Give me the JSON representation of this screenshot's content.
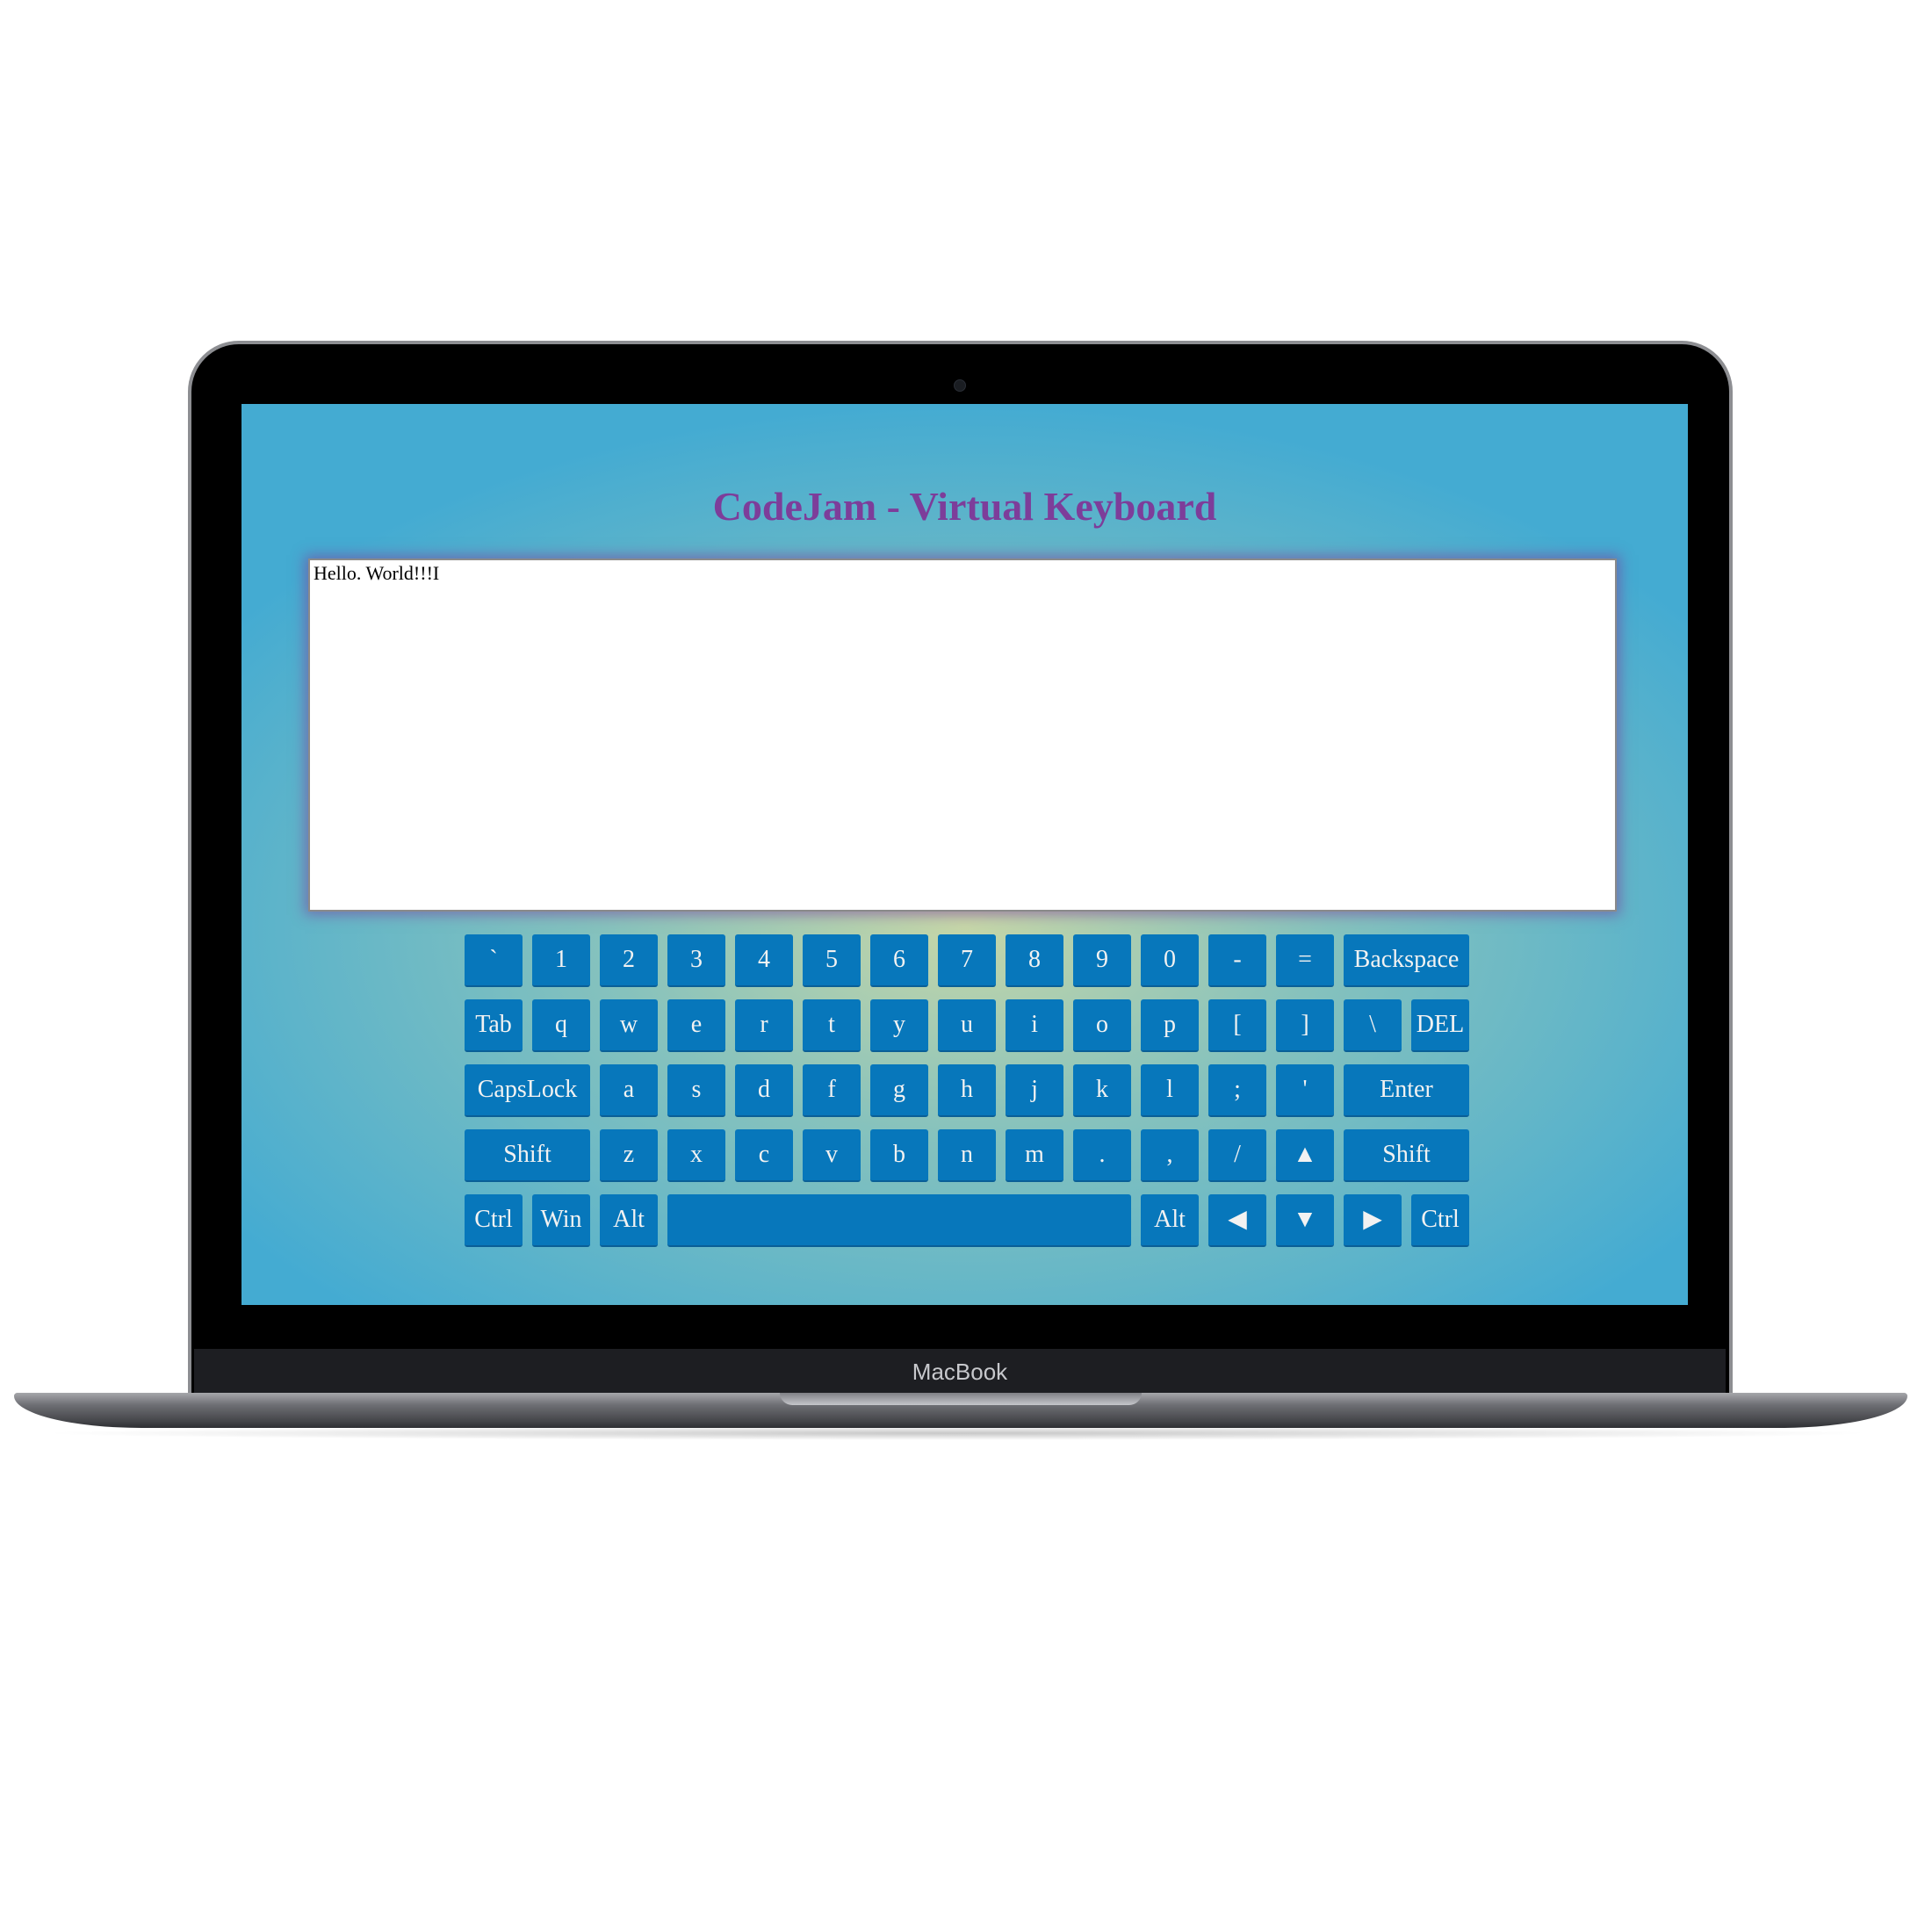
{
  "device": {
    "brand": "MacBook"
  },
  "app": {
    "title": "CodeJam - Virtual Keyboard",
    "textarea_value": "Hello. World!!!I"
  },
  "keyboard": {
    "rows": [
      [
        "`",
        "1",
        "2",
        "3",
        "4",
        "5",
        "6",
        "7",
        "8",
        "9",
        "0",
        "-",
        "=",
        "Backspace"
      ],
      [
        "Tab",
        "q",
        "w",
        "e",
        "r",
        "t",
        "y",
        "u",
        "i",
        "o",
        "p",
        "[",
        "]",
        "\\",
        "DEL"
      ],
      [
        "CapsLock",
        "a",
        "s",
        "d",
        "f",
        "g",
        "h",
        "j",
        "k",
        "l",
        ";",
        "'",
        "Enter"
      ],
      [
        "Shift",
        "z",
        "x",
        "c",
        "v",
        "b",
        "n",
        "m",
        ".",
        ",",
        "/",
        "▲",
        "Shift"
      ],
      [
        "Ctrl",
        "Win",
        "Alt",
        "",
        "Alt",
        "◀",
        "▼",
        "▶",
        "Ctrl"
      ]
    ]
  },
  "colors": {
    "key_bg": "#0777bb",
    "title": "#7d3d9a"
  }
}
